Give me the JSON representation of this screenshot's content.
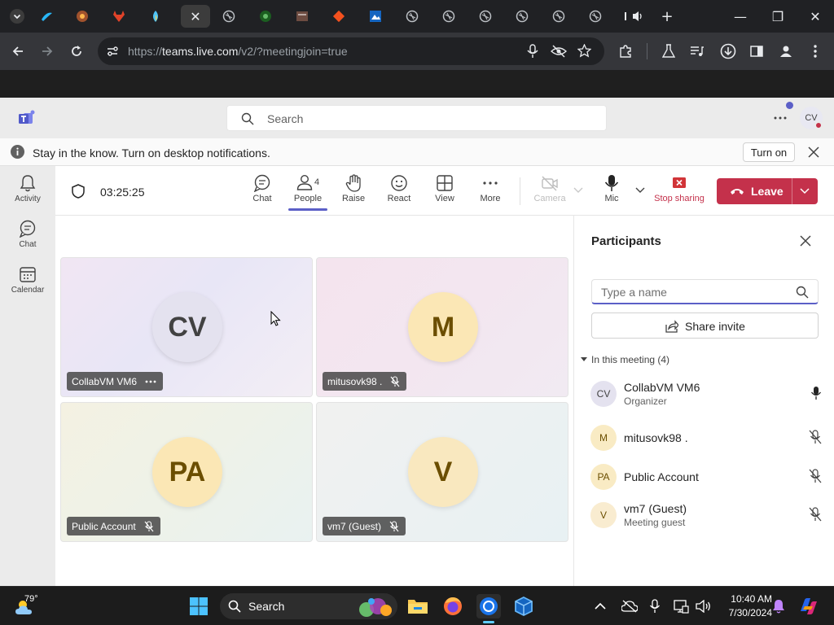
{
  "browser": {
    "url_scheme": "https://",
    "url_host": "teams.live.com",
    "url_path": "/v2/?meetingjoin=true",
    "tab_count_visible": 16
  },
  "teams": {
    "search_placeholder": "Search",
    "user_initials": "CV",
    "notification_text": "Stay in the know. Turn on desktop notifications.",
    "notification_button": "Turn on",
    "rail": [
      {
        "label": "Activity",
        "icon": "bell-icon"
      },
      {
        "label": "Chat",
        "icon": "chat-icon"
      },
      {
        "label": "Calendar",
        "icon": "calendar-icon"
      }
    ],
    "timer": "03:25:25",
    "toolbar": {
      "chat": "Chat",
      "people": "People",
      "people_count": "4",
      "raise": "Raise",
      "react": "React",
      "view": "View",
      "more": "More",
      "camera": "Camera",
      "mic": "Mic",
      "stop_sharing": "Stop sharing",
      "leave": "Leave"
    },
    "tiles": [
      {
        "initials": "CV",
        "name": "CollabVM VM6",
        "muted": false,
        "has_more": true
      },
      {
        "initials": "M",
        "name": "mitusovk98 .",
        "muted": true
      },
      {
        "initials": "PA",
        "name": "Public Account",
        "muted": true
      },
      {
        "initials": "V",
        "name": "vm7 (Guest)",
        "muted": true
      }
    ],
    "participants": {
      "title": "Participants",
      "search_placeholder": "Type a name",
      "share_invite": "Share invite",
      "section": "In this meeting (4)",
      "people": [
        {
          "initials": "CV",
          "name": "CollabVM VM6",
          "role": "Organizer",
          "muted": false
        },
        {
          "initials": "M",
          "name": "mitusovk98 .",
          "role": "",
          "muted": true
        },
        {
          "initials": "PA",
          "name": "Public Account",
          "role": "",
          "muted": true
        },
        {
          "initials": "V",
          "name": "vm7 (Guest)",
          "role": "Meeting guest",
          "muted": true
        }
      ]
    }
  },
  "taskbar": {
    "weather_temp": "79°",
    "search_label": "Search",
    "time": "10:40 AM",
    "date": "7/30/2024"
  },
  "colors": {
    "leave_red": "#c4314b",
    "teams_purple": "#5b5fc7",
    "stop_share_red": "#d13438"
  }
}
